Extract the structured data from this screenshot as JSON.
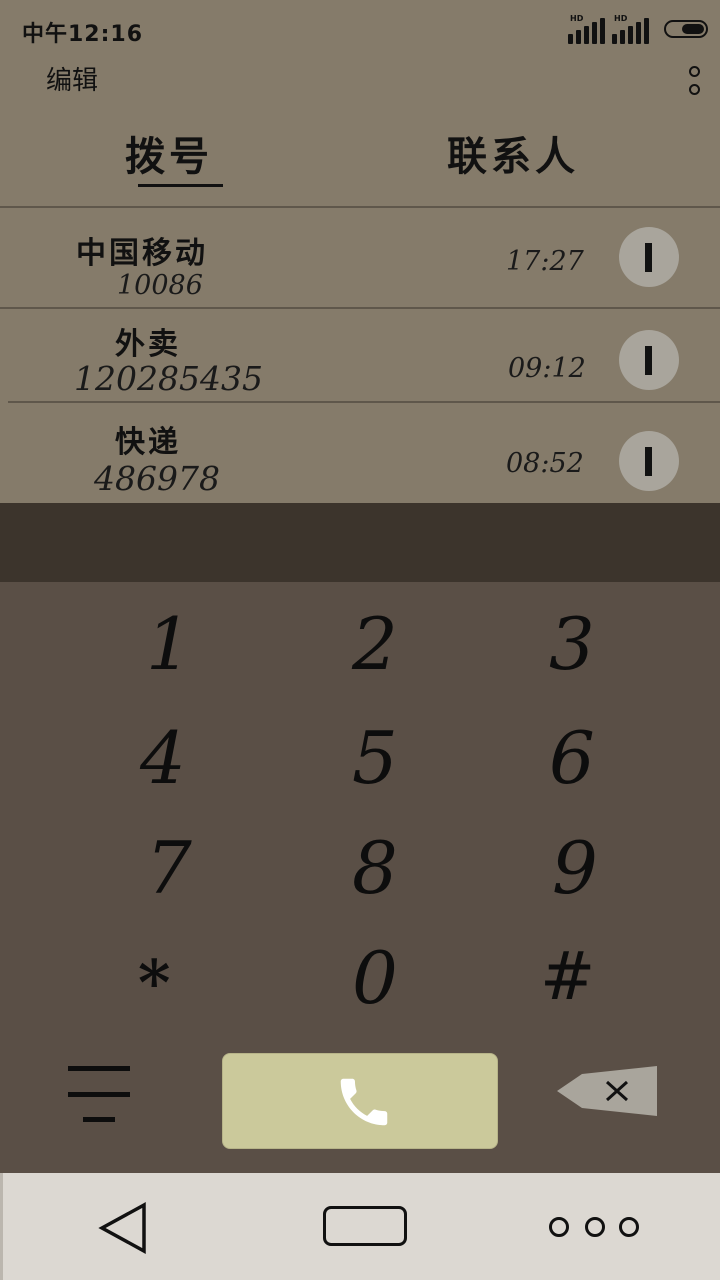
{
  "status_bar": {
    "time": "中午12:16",
    "signal_labels": [
      "HD",
      "HD"
    ],
    "icons": [
      "signal-strength-icon",
      "signal-strength-icon",
      "toggle-icon"
    ]
  },
  "header": {
    "edit_label": "编辑",
    "more_icon": "more-vert-icon"
  },
  "tabs": [
    {
      "label": "拨号",
      "selected": true
    },
    {
      "label": "联系人",
      "selected": false
    }
  ],
  "call_log": [
    {
      "name": "中国移动",
      "number": "10086",
      "time": "17:27",
      "icon": "info-icon"
    },
    {
      "name": "外卖",
      "number": "120285435",
      "time": "09:12",
      "icon": "info-icon"
    },
    {
      "name": "快递",
      "number": "486978",
      "time": "08:52",
      "icon": "info-icon"
    }
  ],
  "dial_pad": {
    "keys": [
      "1",
      "2",
      "3",
      "4",
      "5",
      "6",
      "7",
      "8",
      "9",
      "*",
      "0",
      "#"
    ]
  },
  "actions": {
    "menu_icon": "menu-icon",
    "call_icon": "phone-icon",
    "backspace_icon": "backspace-icon"
  },
  "nav_bar": {
    "icons": [
      "back-icon",
      "home-icon",
      "recents-icon"
    ]
  },
  "colors": {
    "background": "#857b6a",
    "display_band": "#3c342c",
    "dial_pad": "#5a4f46",
    "call_button": "#cbc99b",
    "nav_bar": "#dcd8d2"
  }
}
